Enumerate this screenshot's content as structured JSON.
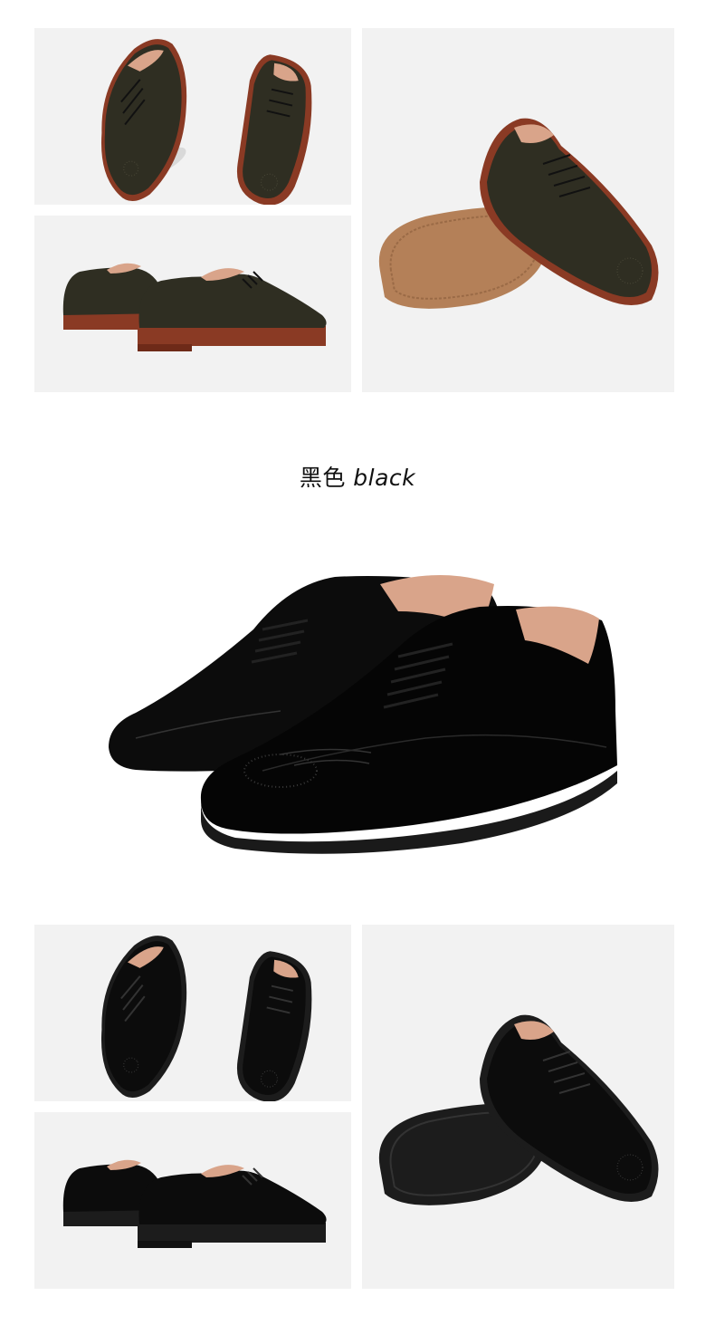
{
  "colors": {
    "tile_bg": "#f2f2f2",
    "brown_leather": "#2f2e22",
    "black_leather": "#0c0c0c",
    "lining": "#d9a48a",
    "brown_sole_edge": "#8a3a24",
    "brown_outsole": "#b48058",
    "black_outsole": "#1c1c1c"
  },
  "color_label": {
    "chinese": "黑色",
    "latin": "black"
  }
}
